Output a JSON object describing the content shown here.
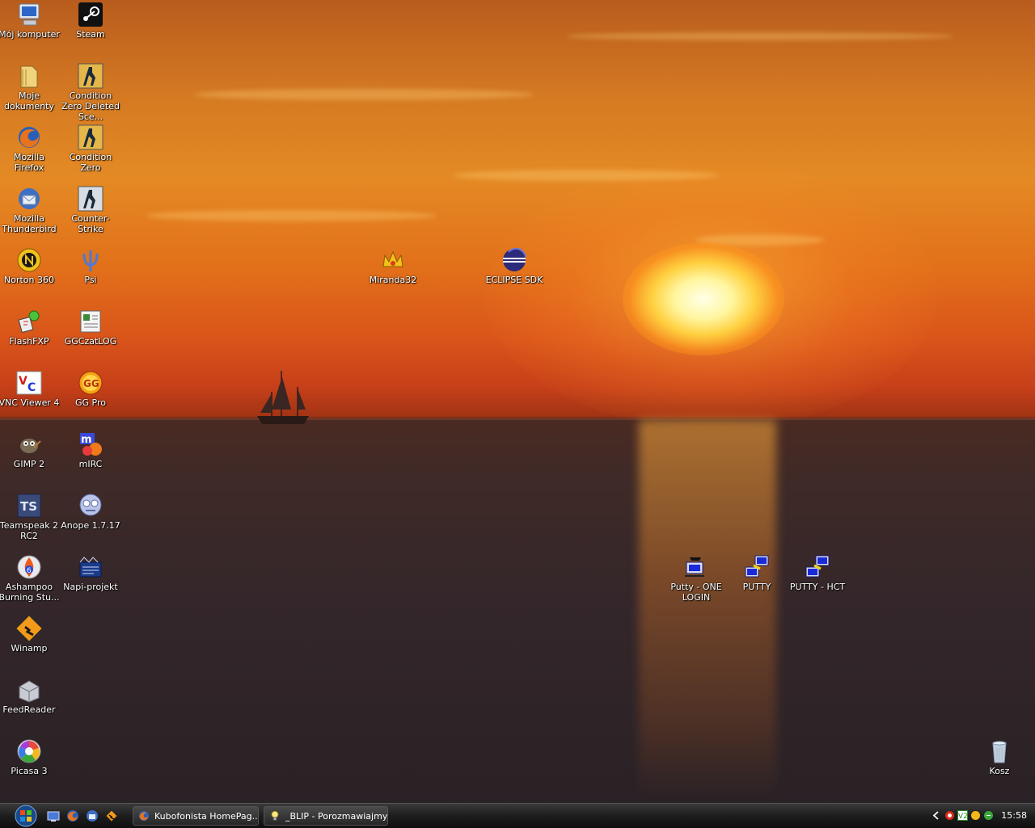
{
  "desktop": {
    "icons_left": [
      {
        "name": "moj-komputer",
        "label": "Mój komputer",
        "icon": "computer-icon"
      },
      {
        "name": "steam",
        "label": "Steam",
        "icon": "steam-icon"
      },
      {
        "name": "moje-dokumenty",
        "label": "Moje dokumenty",
        "icon": "documents-folder-icon"
      },
      {
        "name": "condition-zero-deleted",
        "label": "Condition Zero Deleted Sce...",
        "icon": "counter-strike-icon"
      },
      {
        "name": "mozilla-firefox",
        "label": "Mozilla Firefox",
        "icon": "firefox-icon"
      },
      {
        "name": "condition-zero",
        "label": "Condition Zero",
        "icon": "counter-strike-icon"
      },
      {
        "name": "mozilla-thunderbird",
        "label": "Mozilla Thunderbird",
        "icon": "thunderbird-icon"
      },
      {
        "name": "counter-strike",
        "label": "Counter-Strike",
        "icon": "counter-strike-icon"
      },
      {
        "name": "norton-360",
        "label": "Norton 360",
        "icon": "norton-icon"
      },
      {
        "name": "psi",
        "label": "Psi",
        "icon": "psi-icon"
      },
      {
        "name": "flashfxp",
        "label": "FlashFXP",
        "icon": "flashfxp-icon"
      },
      {
        "name": "ggczatlog",
        "label": "GGCzatLOG",
        "icon": "ggczatlog-icon"
      },
      {
        "name": "vnc-viewer-4",
        "label": "VNC Viewer 4",
        "icon": "vnc-icon"
      },
      {
        "name": "gg-pro",
        "label": "GG Pro",
        "icon": "gadu-gadu-icon"
      },
      {
        "name": "gimp-2",
        "label": "GIMP 2",
        "icon": "gimp-icon"
      },
      {
        "name": "mirc",
        "label": "mIRC",
        "icon": "mirc-icon"
      },
      {
        "name": "teamspeak-2",
        "label": "Teamspeak 2 RC2",
        "icon": "teamspeak-icon"
      },
      {
        "name": "anope",
        "label": "Anope 1.7.17",
        "icon": "anope-icon"
      },
      {
        "name": "ashampoo",
        "label": "Ashampoo Burning Stu...",
        "icon": "ashampoo-icon"
      },
      {
        "name": "napi-projekt",
        "label": "Napi-projekt",
        "icon": "napi-projekt-icon"
      },
      {
        "name": "winamp",
        "label": "Winamp",
        "icon": "winamp-icon"
      },
      {
        "name": "feedreader",
        "label": "FeedReader",
        "icon": "feedreader-icon"
      },
      {
        "name": "picasa-3",
        "label": "Picasa 3",
        "icon": "picasa-icon"
      }
    ],
    "icons_floating": [
      {
        "name": "miranda32",
        "label": "Miranda32",
        "icon": "miranda-icon"
      },
      {
        "name": "eclipse-sdk",
        "label": "ECLIPSE SDK",
        "icon": "eclipse-icon"
      },
      {
        "name": "putty-one-login",
        "label": "Putty - ONE LOGIN",
        "icon": "putty-icon"
      },
      {
        "name": "putty",
        "label": "PUTTY",
        "icon": "putty-icon"
      },
      {
        "name": "putty-hct",
        "label": "PUTTY - HCT",
        "icon": "putty-icon"
      },
      {
        "name": "kosz",
        "label": "Kosz",
        "icon": "recycle-bin-icon"
      }
    ]
  },
  "taskbar": {
    "start_icon": "windows-start-orb-icon",
    "quick_launch": [
      "show-desktop-icon",
      "firefox-icon",
      "thunderbird-icon",
      "winamp-icon"
    ],
    "buttons": [
      {
        "label": "Kubofonista HomePag...",
        "icon": "firefox-icon"
      },
      {
        "label": "_BLIP - Porozmawiajmy",
        "icon": "lightbulb-icon"
      }
    ],
    "tray_icons": [
      "expand-arrow-icon",
      "norton-icon",
      "vnc-tray-icon",
      "gadu-gadu-tray-icon",
      "network-icon"
    ],
    "clock": "15:58"
  }
}
